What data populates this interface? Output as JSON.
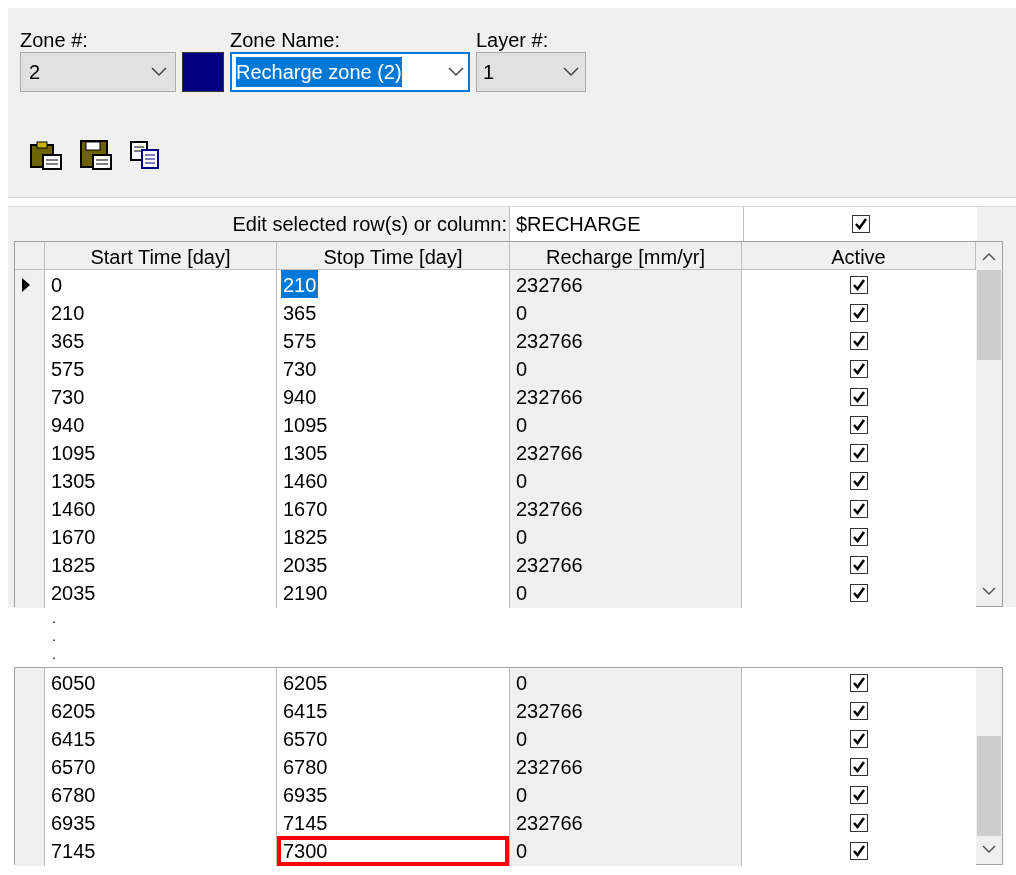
{
  "zone": {
    "label": "Zone #:",
    "value": "2"
  },
  "zone_color": {
    "color": "#000080"
  },
  "zone_name": {
    "label": "Zone Name:",
    "value": "Recharge zone (2)",
    "text_selected": true
  },
  "layer": {
    "label": "Layer #:",
    "value": "1"
  },
  "edit_bar": {
    "label": "Edit selected row(s) or column:",
    "value": "$RECHARGE",
    "checked": true
  },
  "columns": [
    "Start Time [day]",
    "Stop Time [day]",
    "Recharge [mm/yr]",
    "Active"
  ],
  "rows_top": [
    {
      "start": "0",
      "stop": "210",
      "recharge": "232766",
      "active": true,
      "current": true,
      "stop_selected": true,
      "flagged": false
    },
    {
      "start": "210",
      "stop": "365",
      "recharge": "0",
      "active": true,
      "current": false,
      "stop_selected": false,
      "flagged": false
    },
    {
      "start": "365",
      "stop": "575",
      "recharge": "232766",
      "active": true,
      "current": false,
      "stop_selected": false,
      "flagged": false
    },
    {
      "start": "575",
      "stop": "730",
      "recharge": "0",
      "active": true,
      "current": false,
      "stop_selected": false,
      "flagged": false
    },
    {
      "start": "730",
      "stop": "940",
      "recharge": "232766",
      "active": true,
      "current": false,
      "stop_selected": false,
      "flagged": false
    },
    {
      "start": "940",
      "stop": "1095",
      "recharge": "0",
      "active": true,
      "current": false,
      "stop_selected": false,
      "flagged": false
    },
    {
      "start": "1095",
      "stop": "1305",
      "recharge": "232766",
      "active": true,
      "current": false,
      "stop_selected": false,
      "flagged": false
    },
    {
      "start": "1305",
      "stop": "1460",
      "recharge": "0",
      "active": true,
      "current": false,
      "stop_selected": false,
      "flagged": false
    },
    {
      "start": "1460",
      "stop": "1670",
      "recharge": "232766",
      "active": true,
      "current": false,
      "stop_selected": false,
      "flagged": false
    },
    {
      "start": "1670",
      "stop": "1825",
      "recharge": "0",
      "active": true,
      "current": false,
      "stop_selected": false,
      "flagged": false
    },
    {
      "start": "1825",
      "stop": "2035",
      "recharge": "232766",
      "active": true,
      "current": false,
      "stop_selected": false,
      "flagged": false
    },
    {
      "start": "2035",
      "stop": "2190",
      "recharge": "0",
      "active": true,
      "current": false,
      "stop_selected": false,
      "flagged": false
    }
  ],
  "gap_marks": [
    ".",
    ".",
    "."
  ],
  "rows_bottom": [
    {
      "start": "6050",
      "stop": "6205",
      "recharge": "0",
      "active": true,
      "current": false,
      "stop_selected": false,
      "flagged": false
    },
    {
      "start": "6205",
      "stop": "6415",
      "recharge": "232766",
      "active": true,
      "current": false,
      "stop_selected": false,
      "flagged": false
    },
    {
      "start": "6415",
      "stop": "6570",
      "recharge": "0",
      "active": true,
      "current": false,
      "stop_selected": false,
      "flagged": false
    },
    {
      "start": "6570",
      "stop": "6780",
      "recharge": "232766",
      "active": true,
      "current": false,
      "stop_selected": false,
      "flagged": false
    },
    {
      "start": "6780",
      "stop": "6935",
      "recharge": "0",
      "active": true,
      "current": false,
      "stop_selected": false,
      "flagged": false
    },
    {
      "start": "6935",
      "stop": "7145",
      "recharge": "232766",
      "active": true,
      "current": false,
      "stop_selected": false,
      "flagged": false
    },
    {
      "start": "7145",
      "stop": "7300",
      "recharge": "0",
      "active": true,
      "current": false,
      "stop_selected": false,
      "flagged": true
    }
  ]
}
